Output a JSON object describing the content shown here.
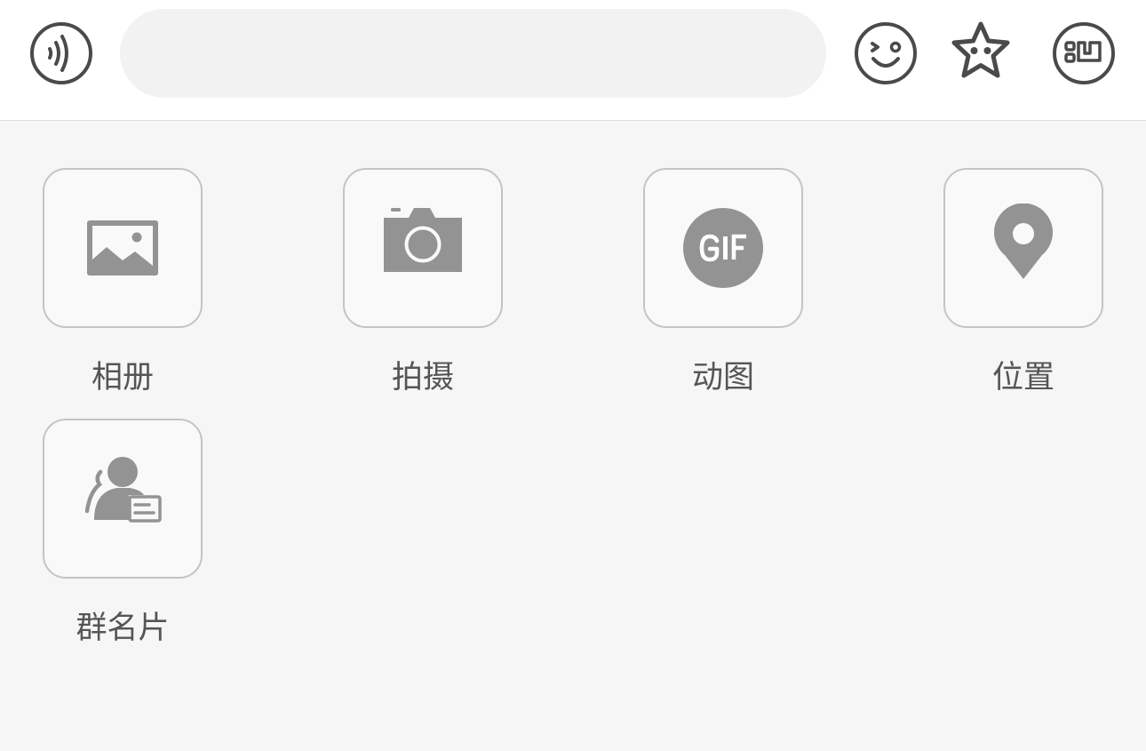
{
  "colors": {
    "icon_gray": "#939393",
    "bar_icon": "#4a4a4a",
    "tile_border": "#c4c4c4",
    "panel_bg": "#f6f6f6",
    "input_bg": "#f2f2f2",
    "label_text": "#555555"
  },
  "input_bar": {
    "icons": [
      "voice-icon",
      "emoji-icon",
      "star-face-icon",
      "more-icon"
    ],
    "message_input": {
      "value": "",
      "placeholder": ""
    }
  },
  "panel": {
    "items": [
      {
        "label": "相册",
        "icon": "image-icon"
      },
      {
        "label": "拍摄",
        "icon": "camera-icon"
      },
      {
        "label": "动图",
        "icon": "gif-icon"
      },
      {
        "label": "位置",
        "icon": "location-pin-icon"
      },
      {
        "label": "群名片",
        "icon": "group-card-icon"
      }
    ]
  }
}
